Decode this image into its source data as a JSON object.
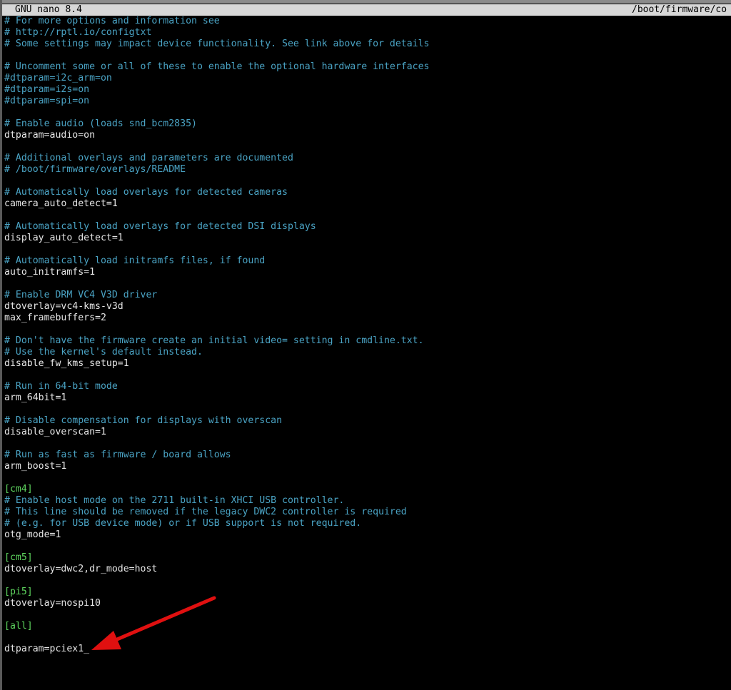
{
  "titlebar": {
    "app": "GNU nano 8.4",
    "path": "/boot/firmware/co"
  },
  "lines": [
    {
      "text": "# For more options and information see",
      "kind": "comment"
    },
    {
      "text": "# http://rptl.io/configtxt",
      "kind": "comment"
    },
    {
      "text": "# Some settings may impact device functionality. See link above for details",
      "kind": "comment"
    },
    {
      "text": "",
      "kind": "blank"
    },
    {
      "text": "# Uncomment some or all of these to enable the optional hardware interfaces",
      "kind": "comment"
    },
    {
      "text": "#dtparam=i2c_arm=on",
      "kind": "comment"
    },
    {
      "text": "#dtparam=i2s=on",
      "kind": "comment"
    },
    {
      "text": "#dtparam=spi=on",
      "kind": "comment"
    },
    {
      "text": "",
      "kind": "blank"
    },
    {
      "text": "# Enable audio (loads snd_bcm2835)",
      "kind": "comment"
    },
    {
      "text": "dtparam=audio=on",
      "kind": "text"
    },
    {
      "text": "",
      "kind": "blank"
    },
    {
      "text": "# Additional overlays and parameters are documented",
      "kind": "comment"
    },
    {
      "text": "# /boot/firmware/overlays/README",
      "kind": "comment"
    },
    {
      "text": "",
      "kind": "blank"
    },
    {
      "text": "# Automatically load overlays for detected cameras",
      "kind": "comment"
    },
    {
      "text": "camera_auto_detect=1",
      "kind": "text"
    },
    {
      "text": "",
      "kind": "blank"
    },
    {
      "text": "# Automatically load overlays for detected DSI displays",
      "kind": "comment"
    },
    {
      "text": "display_auto_detect=1",
      "kind": "text"
    },
    {
      "text": "",
      "kind": "blank"
    },
    {
      "text": "# Automatically load initramfs files, if found",
      "kind": "comment"
    },
    {
      "text": "auto_initramfs=1",
      "kind": "text"
    },
    {
      "text": "",
      "kind": "blank"
    },
    {
      "text": "# Enable DRM VC4 V3D driver",
      "kind": "comment"
    },
    {
      "text": "dtoverlay=vc4-kms-v3d",
      "kind": "text"
    },
    {
      "text": "max_framebuffers=2",
      "kind": "text"
    },
    {
      "text": "",
      "kind": "blank"
    },
    {
      "text": "# Don't have the firmware create an initial video= setting in cmdline.txt.",
      "kind": "comment"
    },
    {
      "text": "# Use the kernel's default instead.",
      "kind": "comment"
    },
    {
      "text": "disable_fw_kms_setup=1",
      "kind": "text"
    },
    {
      "text": "",
      "kind": "blank"
    },
    {
      "text": "# Run in 64-bit mode",
      "kind": "comment"
    },
    {
      "text": "arm_64bit=1",
      "kind": "text"
    },
    {
      "text": "",
      "kind": "blank"
    },
    {
      "text": "# Disable compensation for displays with overscan",
      "kind": "comment"
    },
    {
      "text": "disable_overscan=1",
      "kind": "text"
    },
    {
      "text": "",
      "kind": "blank"
    },
    {
      "text": "# Run as fast as firmware / board allows",
      "kind": "comment"
    },
    {
      "text": "arm_boost=1",
      "kind": "text"
    },
    {
      "text": "",
      "kind": "blank"
    },
    {
      "text": "[cm4]",
      "kind": "section"
    },
    {
      "text": "# Enable host mode on the 2711 built-in XHCI USB controller.",
      "kind": "comment"
    },
    {
      "text": "# This line should be removed if the legacy DWC2 controller is required",
      "kind": "comment"
    },
    {
      "text": "# (e.g. for USB device mode) or if USB support is not required.",
      "kind": "comment"
    },
    {
      "text": "otg_mode=1",
      "kind": "text"
    },
    {
      "text": "",
      "kind": "blank"
    },
    {
      "text": "[cm5]",
      "kind": "section"
    },
    {
      "text": "dtoverlay=dwc2,dr_mode=host",
      "kind": "text"
    },
    {
      "text": "",
      "kind": "blank"
    },
    {
      "text": "[pi5]",
      "kind": "section"
    },
    {
      "text": "dtoverlay=nospi10",
      "kind": "text"
    },
    {
      "text": "",
      "kind": "blank"
    },
    {
      "text": "[all]",
      "kind": "section"
    },
    {
      "text": "",
      "kind": "blank"
    },
    {
      "text": "dtparam=pciex1",
      "kind": "text",
      "cursor": "_"
    }
  ],
  "colors": {
    "background": "#000000",
    "comment": "#4aa3c4",
    "section": "#5fd75f",
    "text": "#e6e6e6",
    "titlebar": "#d7d7d7",
    "arrow": "#e01010"
  },
  "annotation": {
    "icon": "red-arrow-icon"
  }
}
